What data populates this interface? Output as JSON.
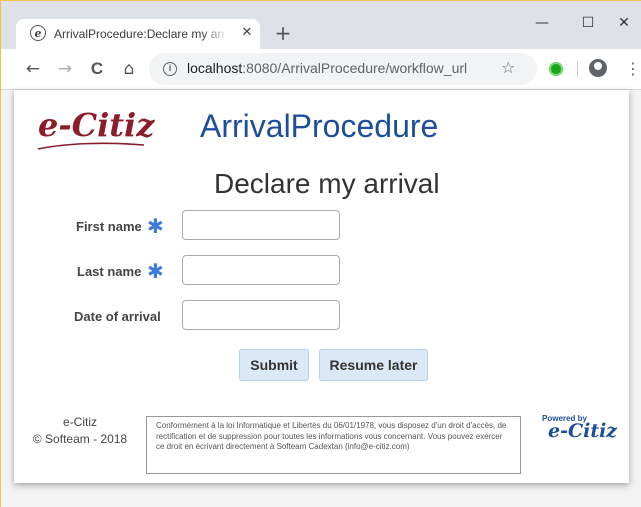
{
  "browser": {
    "tab_title": "ArrivalProcedure:Declare my arrival",
    "tab_close": "✕",
    "new_tab": "+",
    "minimize": "—",
    "maximize": "☐",
    "close": "✕",
    "back": "←",
    "forward": "→",
    "reload": "C",
    "home": "⌂",
    "info": "i",
    "url_host": "localhost",
    "url_path": ":8080/ArrivalProcedure/workflow_url",
    "bookmark": "☆",
    "menu": "⋮"
  },
  "header": {
    "logo": "e-Citiz",
    "app_title": "ArrivalProcedure"
  },
  "form": {
    "title": "Declare my arrival",
    "required_mark": "✱",
    "fields": [
      {
        "label": "First name",
        "value": "",
        "required": true
      },
      {
        "label": "Last name",
        "value": "",
        "required": true
      },
      {
        "label": "Date of arrival",
        "value": "",
        "required": false
      }
    ],
    "submit_label": "Submit",
    "resume_label": "Resume later"
  },
  "footer": {
    "brand": "e-Citiz",
    "copyright": "© Softeam - 2018",
    "notice": "Conformément à la loi Informatique et Libertés du 06/01/1978, vous disposez d'un droit d'accès, de rectification et de suppression pour toutes les informations vous concernant. Vous pouvez exercer ce droit en écrivant directement à Softeam Cadextan (info@e-citiz.com)",
    "powered_by": "Powered by",
    "powered_logo": "e-Citiz"
  },
  "colors": {
    "brand_red": "#8b1c2a",
    "brand_blue": "#1d4e9e",
    "required": "#3c7be0",
    "button_bg": "#dbe9f6"
  }
}
